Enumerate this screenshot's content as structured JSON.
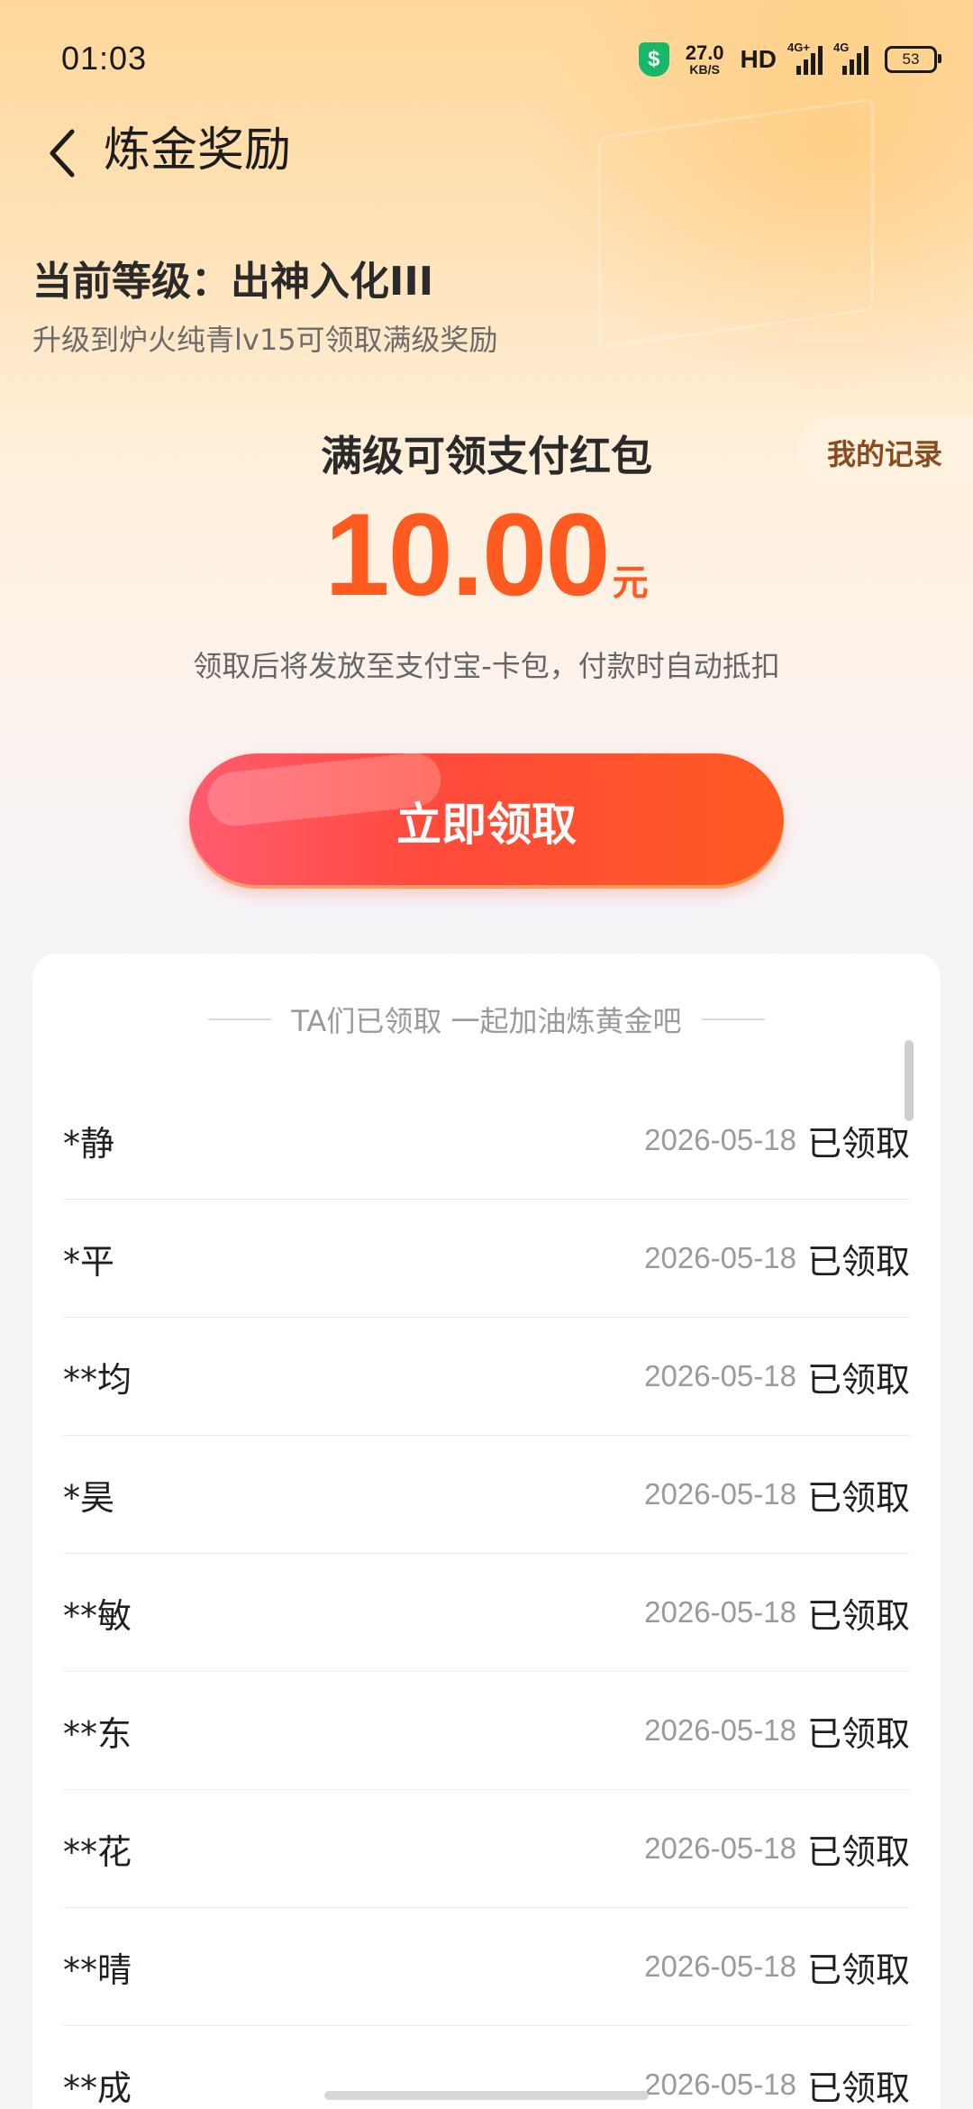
{
  "status_bar": {
    "time": "01:03",
    "speed_value": "27.0",
    "speed_unit": "KB/S",
    "hd": "HD",
    "net1": "4G+",
    "net2": "4G",
    "battery": "53"
  },
  "header": {
    "title": "炼金奖励"
  },
  "level": {
    "current": "当前等级：出神入化III",
    "hint": "升级到炉火纯青lv15可领取满级奖励"
  },
  "record_label": "我的记录",
  "reward": {
    "label": "满级可领支付红包",
    "amount": "10.00",
    "unit": "元",
    "note": "领取后将发放至支付宝-卡包，付款时自动抵扣",
    "claim_label": "立即领取"
  },
  "list": {
    "title": "TA们已领取 一起加油炼黄金吧",
    "rows": [
      {
        "name": "*静",
        "date": "2026-05-18",
        "status": "已领取"
      },
      {
        "name": "*平",
        "date": "2026-05-18",
        "status": "已领取"
      },
      {
        "name": "**均",
        "date": "2026-05-18",
        "status": "已领取"
      },
      {
        "name": "*昊",
        "date": "2026-05-18",
        "status": "已领取"
      },
      {
        "name": "**敏",
        "date": "2026-05-18",
        "status": "已领取"
      },
      {
        "name": "**东",
        "date": "2026-05-18",
        "status": "已领取"
      },
      {
        "name": "**花",
        "date": "2026-05-18",
        "status": "已领取"
      },
      {
        "name": "**晴",
        "date": "2026-05-18",
        "status": "已领取"
      },
      {
        "name": "**成",
        "date": "2026-05-18",
        "status": "已领取"
      }
    ]
  },
  "colors": {
    "accent": "#ff5a1f",
    "button_start": "#ff5b70",
    "button_end": "#ff5a22"
  }
}
